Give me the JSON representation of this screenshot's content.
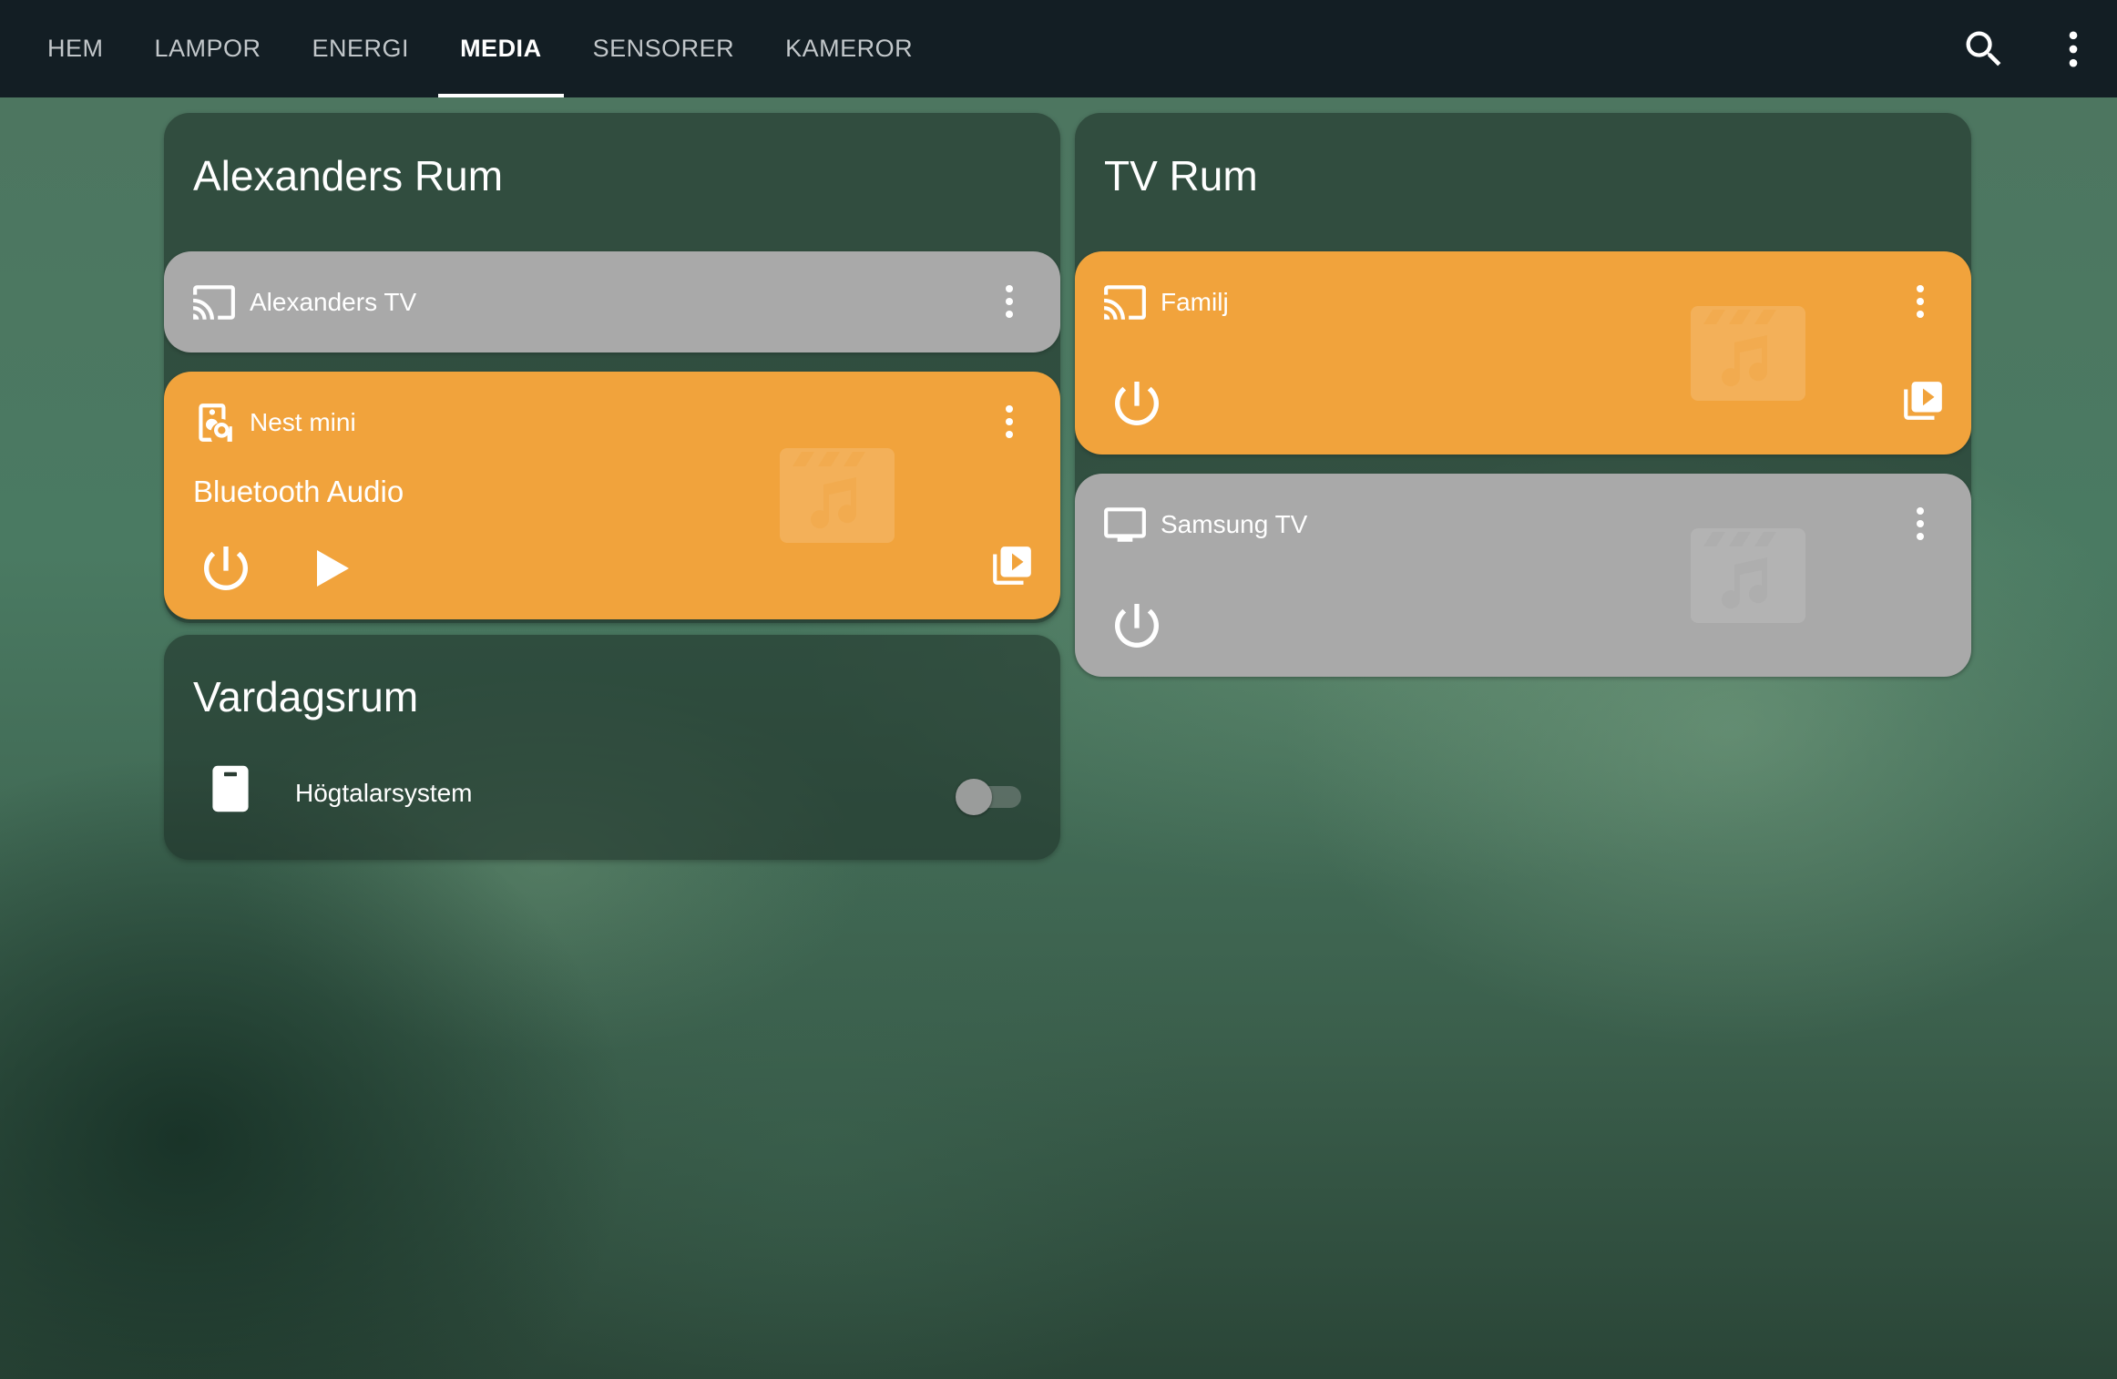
{
  "nav": {
    "tabs": [
      {
        "label": "HEM"
      },
      {
        "label": "LAMPOR"
      },
      {
        "label": "ENERGI"
      },
      {
        "label": "MEDIA",
        "active": true
      },
      {
        "label": "SENSORER"
      },
      {
        "label": "KAMEROR"
      }
    ],
    "icons": [
      "search-icon",
      "more-vertical-icon"
    ]
  },
  "sections": {
    "alexanders_rum": {
      "title": "Alexanders Rum",
      "players": [
        {
          "name": "Alexanders TV",
          "icon": "cast-icon",
          "state": "off",
          "color": "#a9a9a9"
        },
        {
          "name": "Nest mini",
          "icon": "speaker-icon",
          "state": "on",
          "media_title": "Bluetooth Audio",
          "color": "#f1a33c"
        }
      ]
    },
    "vardagsrum": {
      "title": "Vardagsrum",
      "entities": [
        {
          "name": "Högtalarsystem",
          "icon": "speaker-device-icon",
          "toggle": "off"
        }
      ]
    },
    "tv_rum": {
      "title": "TV Rum",
      "players": [
        {
          "name": "Familj",
          "icon": "cast-icon",
          "state": "on",
          "color": "#f1a33c"
        },
        {
          "name": "Samsung TV",
          "icon": "tv-icon",
          "state": "off",
          "color": "#a9a9a9"
        }
      ]
    }
  },
  "colors": {
    "topbar": "#131e24",
    "active_accent": "#f1a33c",
    "inactive_card": "#a9a9a9"
  }
}
